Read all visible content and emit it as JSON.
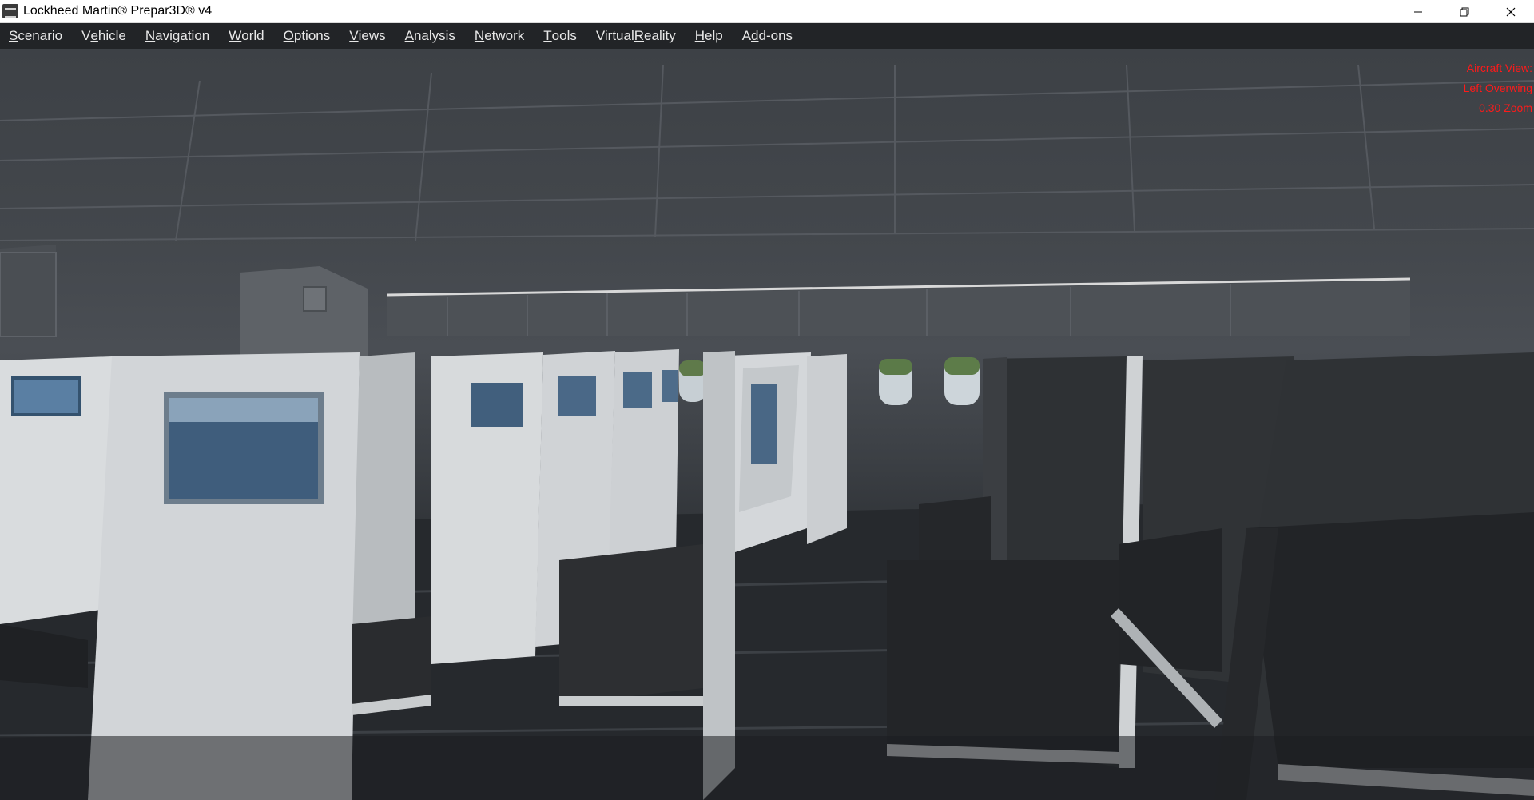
{
  "window": {
    "title": "Lockheed Martin® Prepar3D® v4",
    "controls": {
      "minimize_icon": "minimize-icon",
      "restore_icon": "restore-icon",
      "close_icon": "close-icon"
    }
  },
  "menu": {
    "items": [
      {
        "pre": "",
        "ul": "S",
        "post": "cenario"
      },
      {
        "pre": "V",
        "ul": "e",
        "post": "hicle"
      },
      {
        "pre": "",
        "ul": "N",
        "post": "avigation"
      },
      {
        "pre": "",
        "ul": "W",
        "post": "orld"
      },
      {
        "pre": "",
        "ul": "O",
        "post": "ptions"
      },
      {
        "pre": "",
        "ul": "V",
        "post": "iews"
      },
      {
        "pre": "",
        "ul": "A",
        "post": "nalysis"
      },
      {
        "pre": "",
        "ul": "N",
        "post": "etwork"
      },
      {
        "pre": "",
        "ul": "T",
        "post": "ools"
      },
      {
        "pre": "Virtual ",
        "ul": "R",
        "post": "eality"
      },
      {
        "pre": "",
        "ul": "H",
        "post": "elp"
      },
      {
        "pre": "A",
        "ul": "d",
        "post": "d-ons"
      }
    ]
  },
  "hud": {
    "line1": "Aircraft View:",
    "line2": "Left Overwing",
    "line3": "0.30 Zoom",
    "color": "#ff1a1a"
  },
  "scene": {
    "description_icon": "cabin-view"
  }
}
